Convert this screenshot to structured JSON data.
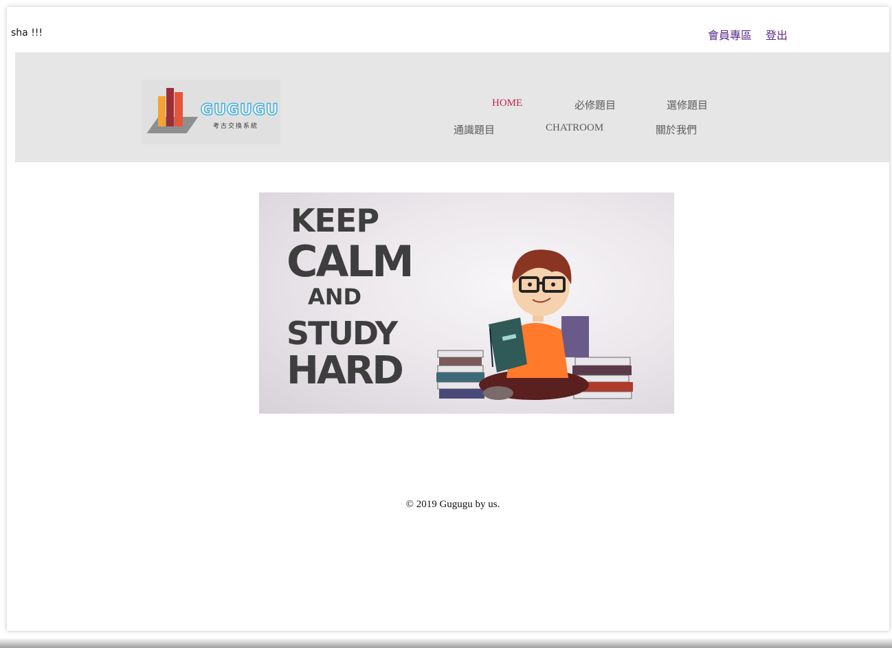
{
  "topbar": {
    "greeting": "sha !!!",
    "member_link": "會員專區",
    "logout_link": "登出"
  },
  "logo": {
    "brand": "GUGUGU",
    "tagline": "考古交換系統"
  },
  "nav": {
    "items": [
      {
        "label": "HOME",
        "active": true
      },
      {
        "label": "必修題目"
      },
      {
        "label": "選修題目"
      },
      {
        "label": "通識題目"
      },
      {
        "label": "CHATROOM"
      },
      {
        "label": "關於我們"
      }
    ]
  },
  "hero": {
    "lines": [
      "KEEP",
      "CALM",
      "AND",
      "STUDY",
      "HARD"
    ]
  },
  "footer": {
    "copyright": "© 2019 Gugugu by us."
  },
  "colors": {
    "link": "#5b2a86",
    "active_nav": "#c0244a",
    "header_bg": "#e6e6e6"
  }
}
